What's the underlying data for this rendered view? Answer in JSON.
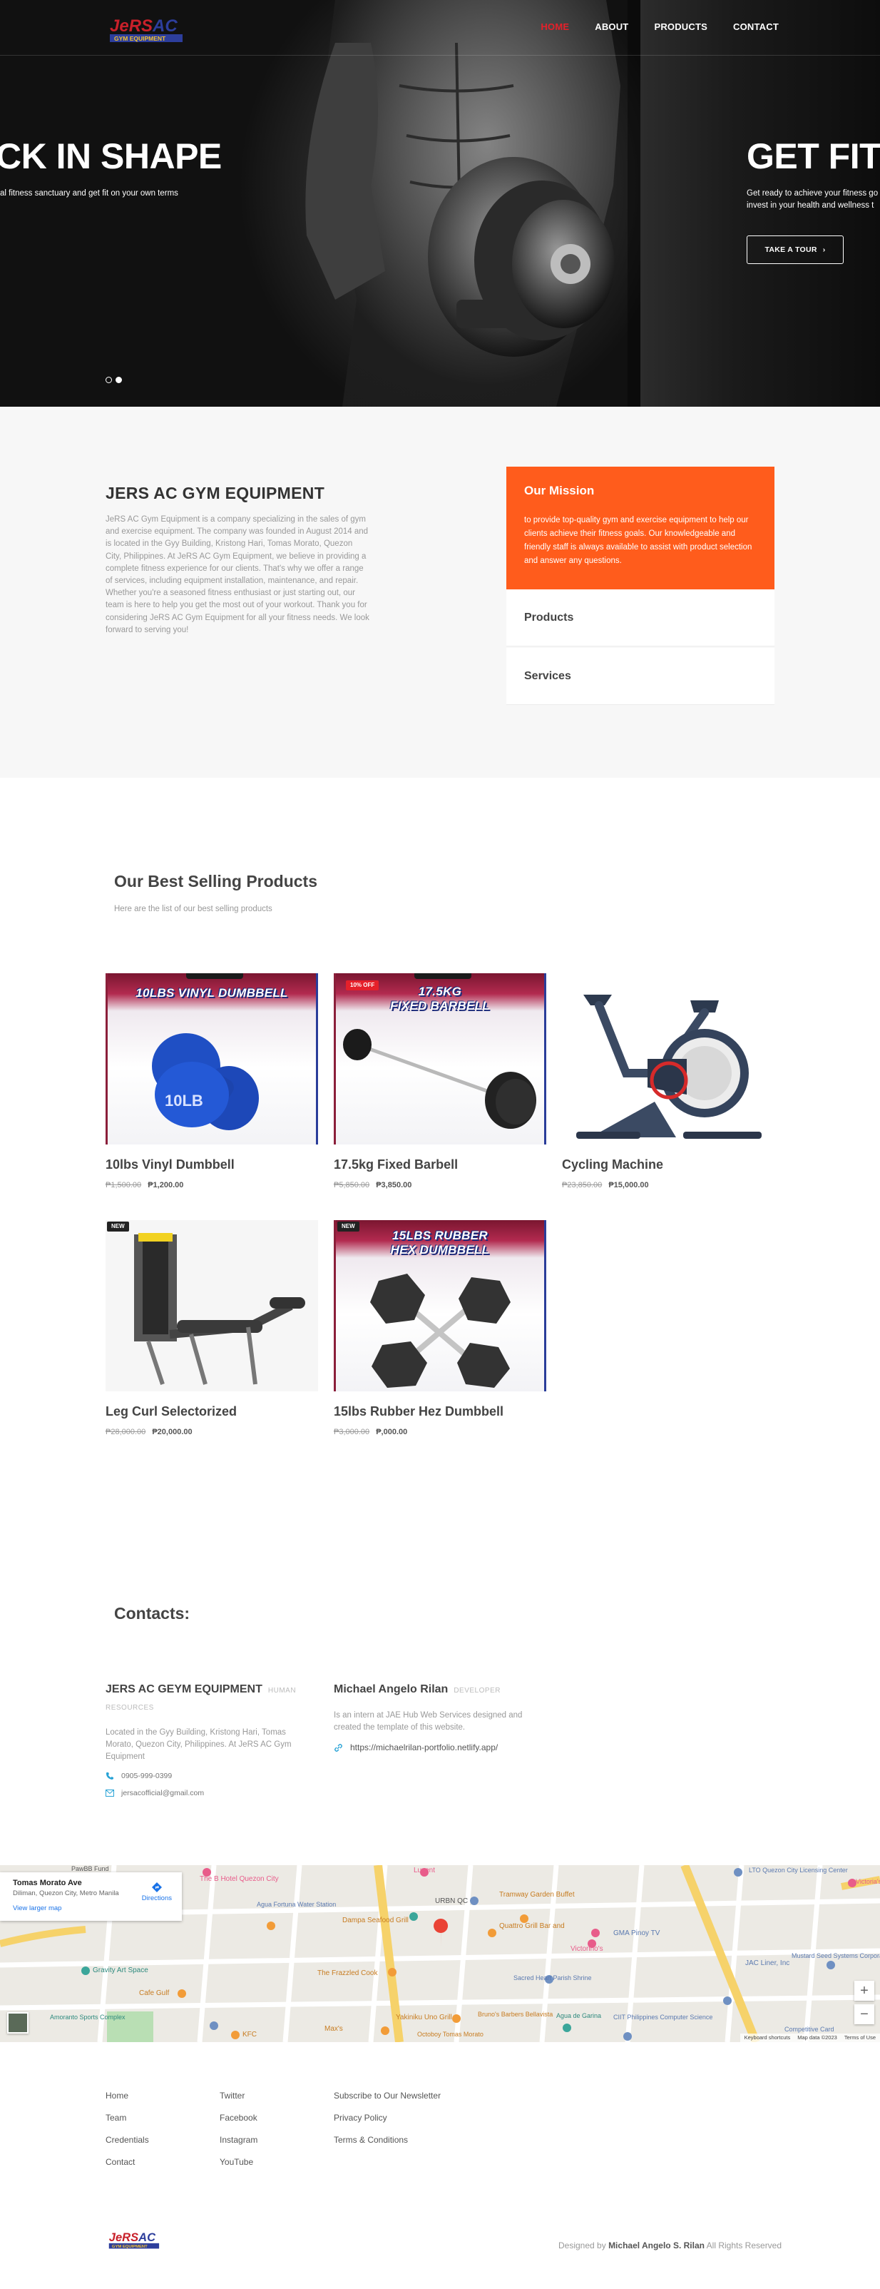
{
  "nav": {
    "logo_text": "JeRS AC",
    "logo_sub": "GYM EQUIPMENT",
    "items": [
      {
        "label": "HOME",
        "active": true
      },
      {
        "label": "ABOUT",
        "active": false
      },
      {
        "label": "PRODUCTS",
        "active": false
      },
      {
        "label": "CONTACT",
        "active": false
      }
    ]
  },
  "hero": {
    "slide_left_title": "CK IN SHAPE",
    "slide_left_sub": "al fitness sanctuary and get fit on your own terms",
    "slide_right_title": "GET FIT!",
    "slide_right_sub_1": "Get ready to achieve your fitness go",
    "slide_right_sub_2": "invest in your health and wellness t",
    "tour_button": "TAKE A TOUR",
    "slider_dots": 2,
    "active_dot": 2
  },
  "about": {
    "title": "JERS AC GYM EQUIPMENT",
    "body": "JeRS AC Gym Equipment is a company specializing in the sales of gym and exercise equipment. The company was founded in August 2014 and is located in the Gyy Building, Kristong Hari, Tomas Morato, Quezon City, Philippines. At JeRS AC Gym Equipment, we believe in providing a complete fitness experience for our clients. That's why we offer a range of services, including equipment installation, maintenance, and repair. Whether you're a seasoned fitness enthusiast or just starting out, our team is here to help you get the most out of your workout. Thank you for considering JeRS AC Gym Equipment for all your fitness needs. We look forward to serving you!",
    "mission_title": "Our Mission",
    "mission_body": "to provide top-quality gym and exercise equipment to help our clients achieve their fitness goals. Our knowledgeable and friendly staff is always available to assist with product selection and answer any questions.",
    "accordion": [
      "Products",
      "Services"
    ]
  },
  "products": {
    "title": "Our Best Selling Products",
    "subtitle": "Here are the list of our best selling products",
    "items": [
      {
        "name": "10lbs Vinyl Dumbbell",
        "old_price": "₱1,500.00",
        "price": "₱1,200.00",
        "poster_title": "10LBS VINYL DUMBBELL",
        "badge": "",
        "label": "10LB"
      },
      {
        "name": "17.5kg Fixed Barbell",
        "old_price": "₱5,850.00",
        "price": "₱3,850.00",
        "poster_title_1": "17.5KG",
        "poster_title_2": "FIXED BARBELL",
        "badge": "10% OFF"
      },
      {
        "name": "Cycling Machine",
        "old_price": "₱23,850.00",
        "price": "₱15,000.00",
        "badge": ""
      },
      {
        "name": "Leg Curl Selectorized",
        "old_price": "₱28,000.00",
        "price": "₱20,000.00",
        "badge": "NEW"
      },
      {
        "name": "15lbs Rubber Hez Dumbbell",
        "old_price": "₱3,000.00",
        "price": "₱,000.00",
        "poster_title_1": "15LBS RUBBER",
        "poster_title_2": "HEX DUMBBELL",
        "badge": "NEW"
      }
    ]
  },
  "contacts": {
    "title": "Contacts:",
    "company": {
      "name": "JERS AC GEYM EQUIPMENT",
      "role": "HUMAN RESOURCES",
      "desc": "Located in the Gyy Building, Kristong Hari, Tomas Morato, Quezon City, Philippines. At JeRS AC Gym Equipment",
      "phone": "0905-999-0399",
      "email": "jersacofficial@gmail.com"
    },
    "developer": {
      "name": "Michael Angelo Rilan",
      "role": "DEVELOPER",
      "desc": "Is an intern at JAE Hub Web Services designed and created the template of this website.",
      "link": "https://michaelrilan-portfolio.netlify.app/"
    }
  },
  "map": {
    "place": "Tomas Morato Ave",
    "address": "Diliman, Quezon City, Metro Manila",
    "view_larger": "View larger map",
    "directions": "Directions",
    "labels": {
      "hotel": "The B Hotel Quezon City",
      "lto": "LTO Quezon City Licensing Center",
      "victoria": "Victoria's",
      "tramway": "Tramway Garden Buffet",
      "urbn": "URBN QC",
      "dampa": "Dampa Seafood Grill",
      "quattro": "Quattro Grill Bar and",
      "gma": "GMA Pinoy TV",
      "victorinos": "Victorino's",
      "frazzled": "The Frazzled Cook",
      "sacred": "Sacred Heart Parish Shrine",
      "gravity": "Gravity Art Space",
      "cafe": "Cafe Gulf",
      "jac": "JAC Liner, Inc",
      "mustard": "Mustard Seed Systems Corporation",
      "yakiniku": "Yakiniku Uno Grill",
      "bruno": "Bruno's Barbers Bellavista",
      "agua": "Agua de Garina",
      "ciit": "CIIT Philippines Computer Science",
      "sports": "Amoranto Sports Complex",
      "octoboy": "Octoboy Tomas Morato",
      "max": "Max's",
      "kfc": "KFC",
      "luxe": "Luxent",
      "paw": "PawBB Fund",
      "aguaf": "Agua Fortuna Water Station",
      "competitive": "Competitive Card"
    },
    "footer_keyboard": "Keyboard shortcuts",
    "footer_data": "Map data ©2023",
    "footer_terms": "Terms of Use"
  },
  "footer": {
    "col1": [
      "Home",
      "Team",
      "Credentials",
      "Contact"
    ],
    "col2": [
      "Twitter",
      "Facebook",
      "Instagram",
      "YouTube"
    ],
    "col3": [
      "Subscribe to Our Newsletter",
      "Privacy Policy",
      "Terms & Conditions"
    ],
    "designed_prefix": "Designed by",
    "designed_name": "Michael Angelo S. Rilan",
    "designed_suffix": "All Rights Reserved"
  },
  "colors": {
    "accent": "#ff5c1c",
    "nav_active": "#e5202a",
    "hero_bg": "#111111",
    "section_bg": "#f7f7f7",
    "text_dark": "#444444",
    "text_muted": "#999999"
  }
}
